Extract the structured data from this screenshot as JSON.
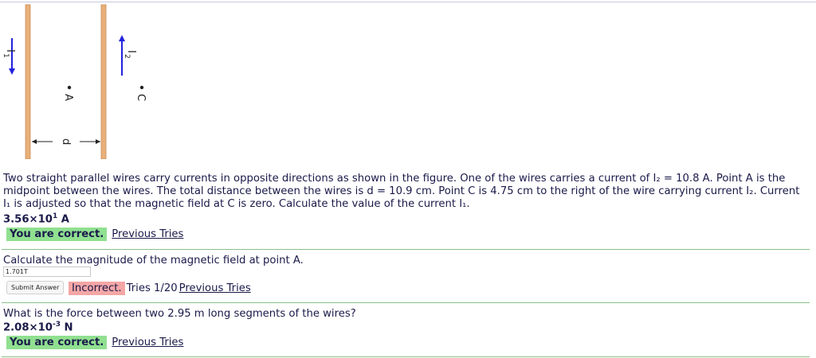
{
  "figure": {
    "label_i1": "I",
    "label_i1_sub": "1",
    "label_i2": "I",
    "label_i2_sub": "2",
    "label_a": "A",
    "label_c": "C",
    "label_d": "d",
    "wire_color": "#e8b07a",
    "arrow_color": "#2222dd"
  },
  "problem": {
    "line1": "Two straight parallel wires carry currents in opposite directions as shown in the figure. One of the wires carries a current of I₂ = 10.8 A. Point A is the",
    "line2": "midpoint between the wires. The total distance between the wires is d = 10.9 cm. Point C is 4.75 cm to the right of the wire carrying current I₂. Current",
    "line3": "I₁ is adjusted so that the magnetic field at C is zero. Calculate the value of the current I₁."
  },
  "part1": {
    "answer_mantissa": "3.56×10",
    "answer_exp": "1",
    "answer_unit": " A",
    "status": "You are correct.",
    "previous_tries": "Previous Tries"
  },
  "part2": {
    "question": "Calculate the magnitude of the magnetic field at point A.",
    "input_value": "1.701T",
    "submit_label": "Submit Answer",
    "status": "Incorrect.",
    "tries": "Tries 1/20",
    "previous_tries": "Previous Tries"
  },
  "part3": {
    "question": "What is the force between two 2.95 m long segments of the wires?",
    "answer_mantissa": "2.08×10",
    "answer_exp": "-3",
    "answer_unit": " N",
    "status": "You are correct.",
    "previous_tries": "Previous Tries"
  }
}
